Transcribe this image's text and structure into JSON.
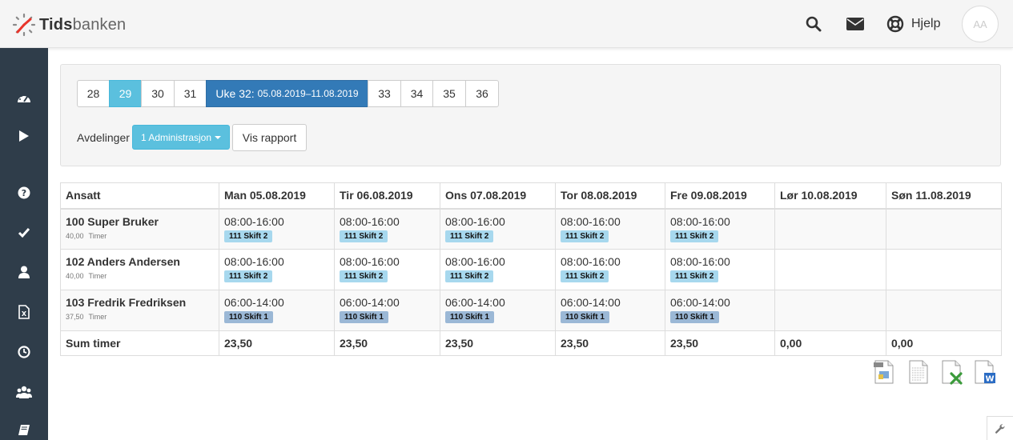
{
  "header": {
    "logo_part1": "Tids",
    "logo_part2": "banken",
    "search_icon": "search-icon",
    "mail_icon": "envelope-icon",
    "help_icon": "lifebuoy-icon",
    "help_label": "Hjelp",
    "avatar_initials": "AA"
  },
  "sidebar": {
    "items": [
      {
        "icon": "dashboard-icon"
      },
      {
        "icon": "play-icon"
      },
      {
        "icon": "question-icon"
      },
      {
        "icon": "check-icon"
      },
      {
        "icon": "user-icon"
      },
      {
        "icon": "excel-file-icon"
      },
      {
        "icon": "clock-icon"
      },
      {
        "icon": "users-icon"
      },
      {
        "icon": "book-icon"
      }
    ]
  },
  "filters": {
    "weeks": [
      {
        "label": "28",
        "state": "normal"
      },
      {
        "label": "29",
        "state": "light"
      },
      {
        "label": "30",
        "state": "normal"
      },
      {
        "label": "31",
        "state": "normal"
      },
      {
        "label": "Uke 32:",
        "range": "05.08.2019–11.08.2019",
        "state": "current"
      },
      {
        "label": "33",
        "state": "normal"
      },
      {
        "label": "34",
        "state": "normal"
      },
      {
        "label": "35",
        "state": "normal"
      },
      {
        "label": "36",
        "state": "normal"
      }
    ],
    "department_label": "Avdelinger",
    "department_value": "1 Administrasjon",
    "report_button": "Vis rapport"
  },
  "table": {
    "columns": [
      "Ansatt",
      "Man 05.08.2019",
      "Tir 06.08.2019",
      "Ons 07.08.2019",
      "Tor 08.08.2019",
      "Fre 09.08.2019",
      "Lør 10.08.2019",
      "Søn 11.08.2019"
    ],
    "rows": [
      {
        "name": "100 Super Bruker",
        "hours": "40,00",
        "hours_unit": "Timer",
        "days": [
          {
            "time": "08:00-16:00",
            "shift": "111 Skift 2"
          },
          {
            "time": "08:00-16:00",
            "shift": "111 Skift 2"
          },
          {
            "time": "08:00-16:00",
            "shift": "111 Skift 2"
          },
          {
            "time": "08:00-16:00",
            "shift": "111 Skift 2"
          },
          {
            "time": "08:00-16:00",
            "shift": "111 Skift 2"
          },
          {
            "time": "",
            "shift": ""
          },
          {
            "time": "",
            "shift": ""
          }
        ]
      },
      {
        "name": "102 Anders Andersen",
        "hours": "40,00",
        "hours_unit": "Timer",
        "days": [
          {
            "time": "08:00-16:00",
            "shift": "111 Skift 2"
          },
          {
            "time": "08:00-16:00",
            "shift": "111 Skift 2"
          },
          {
            "time": "08:00-16:00",
            "shift": "111 Skift 2"
          },
          {
            "time": "08:00-16:00",
            "shift": "111 Skift 2"
          },
          {
            "time": "08:00-16:00",
            "shift": "111 Skift 2"
          },
          {
            "time": "",
            "shift": ""
          },
          {
            "time": "",
            "shift": ""
          }
        ]
      },
      {
        "name": "103 Fredrik Fredriksen",
        "hours": "37,50",
        "hours_unit": "Timer",
        "days": [
          {
            "time": "06:00-14:00",
            "shift": "110 Skift 1"
          },
          {
            "time": "06:00-14:00",
            "shift": "110 Skift 1"
          },
          {
            "time": "06:00-14:00",
            "shift": "110 Skift 1"
          },
          {
            "time": "06:00-14:00",
            "shift": "110 Skift 1"
          },
          {
            "time": "06:00-14:00",
            "shift": "110 Skift 1"
          },
          {
            "time": "",
            "shift": ""
          },
          {
            "time": "",
            "shift": ""
          }
        ]
      }
    ],
    "sum_label": "Sum timer",
    "sums": [
      "23,50",
      "23,50",
      "23,50",
      "23,50",
      "23,50",
      "0,00",
      "0,00"
    ]
  },
  "export": [
    {
      "icon": "pdf-export-icon"
    },
    {
      "icon": "text-export-icon"
    },
    {
      "icon": "excel-export-icon"
    },
    {
      "icon": "word-export-icon"
    }
  ],
  "colors": {
    "sidebar_bg": "#2f3d4a",
    "primary": "#337ab7",
    "info": "#5bc0de",
    "shift2_tag": "#a7d8ee",
    "shift1_tag": "#9bb8d6",
    "logo_red": "#e8352b"
  }
}
